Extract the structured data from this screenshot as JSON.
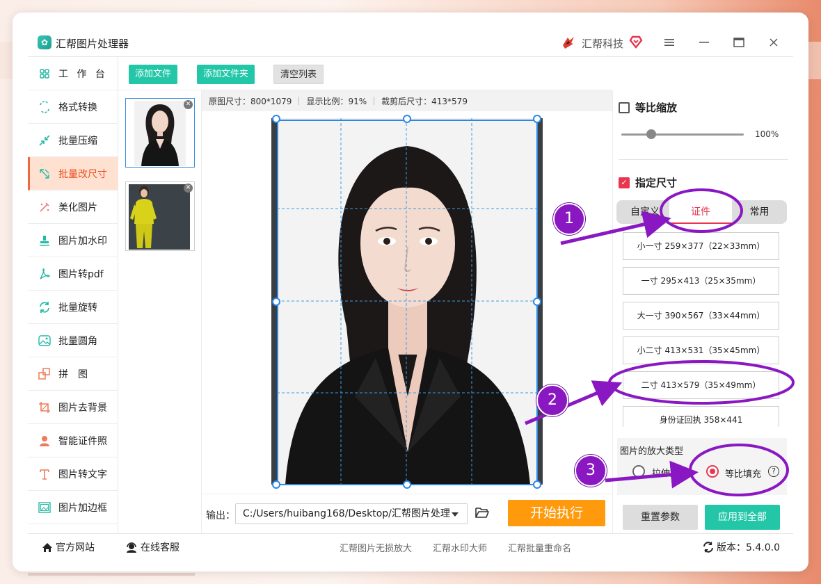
{
  "app": {
    "title": "汇帮图片处理器",
    "brand": "汇帮科技"
  },
  "sidebar": {
    "items": [
      {
        "label": "工 作 台",
        "icon": "grid-icon"
      },
      {
        "label": "格式转换",
        "icon": "convert-icon"
      },
      {
        "label": "批量压缩",
        "icon": "compress-icon"
      },
      {
        "label": "批量改尺寸",
        "icon": "resize-icon"
      },
      {
        "label": "美化图片",
        "icon": "magic-wand-icon"
      },
      {
        "label": "图片加水印",
        "icon": "stamp-icon"
      },
      {
        "label": "图片转pdf",
        "icon": "pdf-icon"
      },
      {
        "label": "批量旋转",
        "icon": "rotate-icon"
      },
      {
        "label": "批量圆角",
        "icon": "image-icon"
      },
      {
        "label": "拼　图",
        "icon": "puzzle-icon"
      },
      {
        "label": "图片去背景",
        "icon": "crop-icon"
      },
      {
        "label": "智能证件照",
        "icon": "person-icon"
      },
      {
        "label": "图片转文字",
        "icon": "text-icon"
      },
      {
        "label": "图片加边框",
        "icon": "frame-icon"
      }
    ],
    "active_index": 3
  },
  "toolbar": {
    "add_file": "添加文件",
    "add_folder": "添加文件夹",
    "clear_list": "清空列表"
  },
  "info": {
    "original_size": "原图尺寸：800*1079",
    "display_ratio": "显示比例：91%",
    "cropped_size": "裁剪后尺寸：413*579"
  },
  "output": {
    "label": "输出：",
    "path": "C:/Users/huibang168/Desktop/汇帮图片处理",
    "start": "开始执行"
  },
  "panel": {
    "proportional_scale": {
      "label": "等比缩放",
      "checked": false,
      "value": "100%",
      "slider_fraction": 0.25
    },
    "specify_size": {
      "label": "指定尺寸",
      "checked": true
    },
    "tabs": [
      "自定义",
      "证件",
      "常用"
    ],
    "active_tab": 1,
    "sizes": [
      "小一寸 259×377（22×33mm）",
      "一寸 295×413（25×35mm）",
      "大一寸 390×567（33×44mm）",
      "小二寸 413×531（35×45mm）",
      "二寸 413×579（35×49mm）",
      "身份证回执 358×441"
    ],
    "enlarge_type": {
      "title": "图片的放大类型",
      "options": [
        "拉伸放",
        "等比填充"
      ],
      "selected": 1,
      "help": "?"
    },
    "reset": "重置参数",
    "apply_all": "应用到全部"
  },
  "bottom": {
    "official_site": "官方网站",
    "online_service": "在线客服",
    "links": [
      "汇帮图片无损放大",
      "汇帮水印大师",
      "汇帮批量重命名"
    ],
    "version": "版本：5.4.0.0"
  },
  "annotations": {
    "steps": [
      "1",
      "2",
      "3"
    ],
    "color": "#8a18c2"
  },
  "colors": {
    "accent_green": "#23c7a8",
    "accent_orange": "#ff9a0d",
    "accent_red": "#e8364f",
    "active_sidebar_bg": "#ffe1d1"
  }
}
